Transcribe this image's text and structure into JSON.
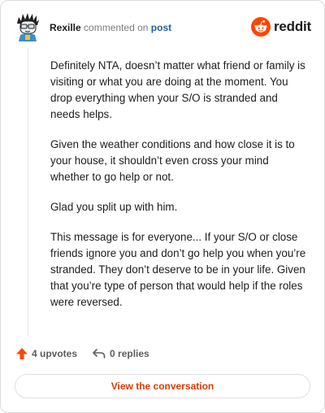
{
  "header": {
    "username": "Rexille",
    "action_text": "commented on",
    "post_link": "post",
    "brand_wordmark": "reddit"
  },
  "comment": {
    "paragraphs": [
      "Definitely NTA, doesn’t matter what friend or family is visiting or what you are doing at the moment. You drop everything when your S/O is stranded and needs helps.",
      "Given the weather conditions and how close it is to your house, it shouldn’t even cross your mind whether to go help or not.",
      "Glad you split up with him.",
      "This message is for everyone... If your S/O or close friends ignore you and don’t go help you when you’re stranded. They don’t deserve to be in your life. Given that you’re type of person that would help if the roles were reversed."
    ]
  },
  "actions": {
    "upvotes_label": "4 upvotes",
    "replies_label": "0 replies"
  },
  "cta": {
    "label": "View the conversation"
  },
  "colors": {
    "accent": "#d93a00",
    "reddit_orange": "#ff4500",
    "link_blue": "#1f5fa8"
  }
}
